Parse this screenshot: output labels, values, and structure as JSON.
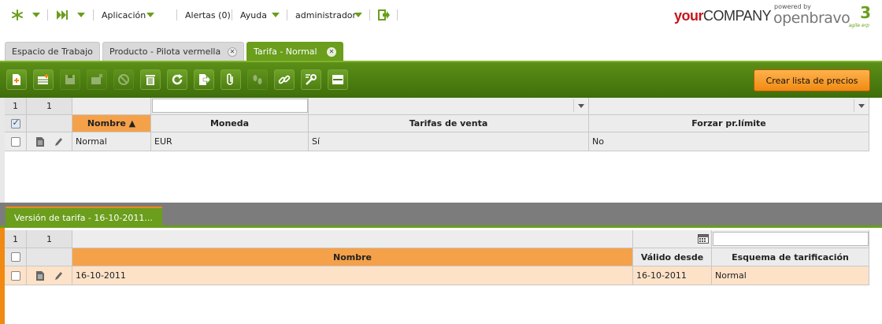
{
  "topnav": {
    "app_label": "Aplicación",
    "alerts_label": "Alertas (0)",
    "help_label": "Ayuda",
    "user_label": "administrador",
    "logo_your_bold": "your",
    "logo_your_rest": "COMPANY",
    "powered_by": "powered by",
    "logo_ob": "openbravo",
    "logo_tagline": "agile erp"
  },
  "tabs": [
    {
      "label": "Espacio de Trabajo",
      "closable": false,
      "active": false
    },
    {
      "label": "Producto - Pilota vermella",
      "closable": true,
      "active": false
    },
    {
      "label": "Tarifa - Normal",
      "closable": true,
      "active": true
    }
  ],
  "toolbar": {
    "create_button": "Crear lista de precios",
    "icons": [
      "new-document-icon",
      "new-row-icon",
      "save-icon",
      "undo-icon",
      "cancel-icon",
      "delete-icon",
      "refresh-icon",
      "export-icon",
      "attachment-icon",
      "audit-trail-icon",
      "link-icon",
      "tools-icon",
      "layout-icon"
    ]
  },
  "grid1": {
    "counter_selected": "1",
    "counter_total": "1",
    "columns": [
      "Nombre",
      "Moneda",
      "Tarifas de venta",
      "Forzar pr.límite"
    ],
    "sort_column": "Nombre",
    "sort_indicator": "▲",
    "rows": [
      [
        "Normal",
        "EUR",
        "Sí",
        "No"
      ]
    ]
  },
  "section2": {
    "tab_label": "Versión de tarifa - 16-10-2011..."
  },
  "grid2": {
    "counter_selected": "1",
    "counter_total": "1",
    "columns": [
      "Nombre",
      "Válido desde",
      "Esquema de tarificación"
    ],
    "rows": [
      [
        "16-10-2011",
        "16-10-2011",
        "Normal"
      ]
    ]
  },
  "colors": {
    "brand_green": "#6a9e1c",
    "accent_orange": "#f08a12",
    "selected_row": "#fde2c8"
  }
}
